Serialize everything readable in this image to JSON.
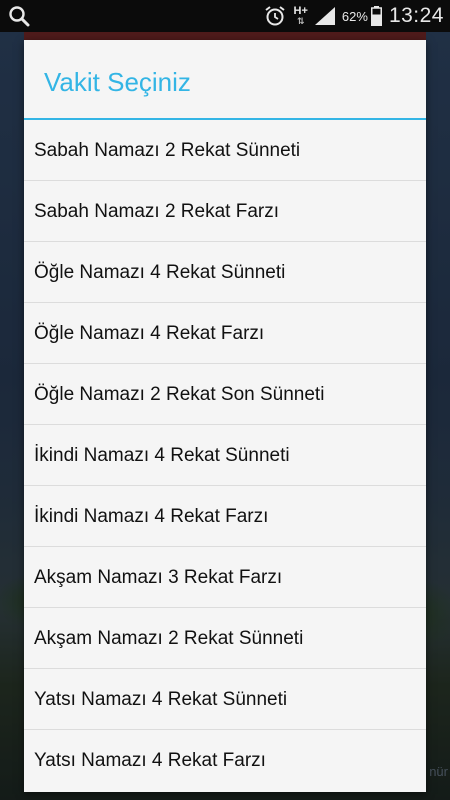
{
  "status_bar": {
    "network_label": "H+",
    "battery_percent": "62%",
    "time": "13:24",
    "icons": [
      "search-icon",
      "alarm-icon",
      "network-arrows-icon",
      "signal-icon",
      "battery-icon"
    ]
  },
  "background_app": {
    "partial_text": "nür"
  },
  "dialog": {
    "title": "Vakit Seçiniz",
    "accent_color": "#33b5e5",
    "items": [
      "Sabah Namazı 2 Rekat Sünneti",
      "Sabah Namazı 2 Rekat Farzı",
      "Öğle Namazı 4 Rekat Sünneti",
      "Öğle Namazı 4 Rekat Farzı",
      "Öğle Namazı 2 Rekat Son Sünneti",
      "İkindi Namazı 4 Rekat Sünneti",
      "İkindi Namazı 4 Rekat Farzı",
      "Akşam Namazı 3 Rekat Farzı",
      "Akşam Namazı 2 Rekat Sünneti",
      "Yatsı Namazı 4 Rekat Sünneti",
      "Yatsı Namazı 4 Rekat Farzı"
    ]
  }
}
